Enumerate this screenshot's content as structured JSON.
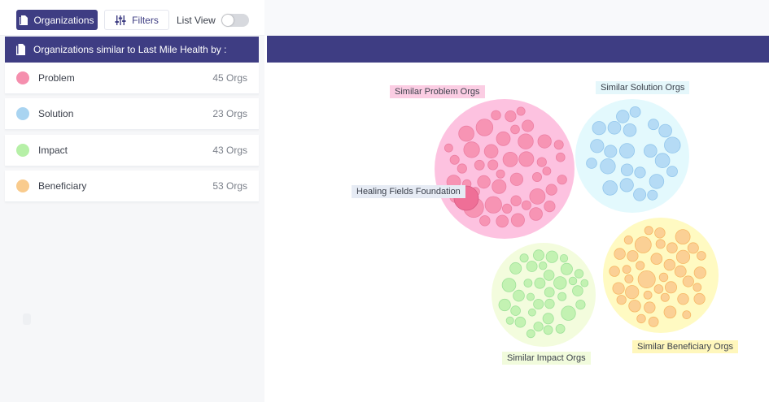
{
  "toolbar": {
    "organizations_label": "Organizations",
    "filters_label": "Filters",
    "list_view_label": "List View",
    "list_view_on": false
  },
  "panel": {
    "header": "Organizations similar to Last Mile Health by :",
    "categories": [
      {
        "label": "Problem",
        "count": "45 Orgs",
        "color": "#f58fae"
      },
      {
        "label": "Solution",
        "count": "23 Orgs",
        "color": "#a9d4f1"
      },
      {
        "label": "Impact",
        "count": "43 Orgs",
        "color": "#b6f0a7"
      },
      {
        "label": "Beneficiary",
        "count": "53 Orgs",
        "color": "#f9cb8d"
      }
    ]
  },
  "viz": {
    "groups": {
      "problem": {
        "label": "Similar Problem Orgs",
        "hull": "#fdc2e0",
        "bubble": "#f794b4",
        "stroke": "#ec7fa3",
        "label_bg": "#fbcde3"
      },
      "solution": {
        "label": "Similar Solution Orgs",
        "hull": "#e3f9fd",
        "bubble": "#b5dbf5",
        "stroke": "#92c6ec",
        "label_bg": "#e5f7fb"
      },
      "impact": {
        "label": "Similar Impact Orgs",
        "hull": "#f3fcdd",
        "bubble": "#c3f2b2",
        "stroke": "#9fe29a",
        "label_bg": "#f1fbdc"
      },
      "beneficiary": {
        "label": "Similar Beneficiary Orgs",
        "hull": "#fffac2",
        "bubble": "#fbd095",
        "stroke": "#f7b865",
        "label_bg": "#fff7bc"
      }
    },
    "highlight_label": "Healing Fields Foundation",
    "highlight_color": "#ef6f97",
    "highlight_label_bg": "#e6ebf4"
  }
}
